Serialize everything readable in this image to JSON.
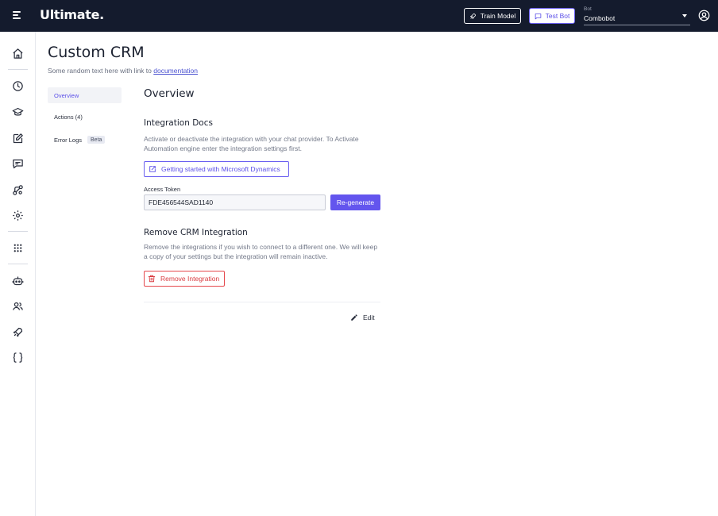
{
  "topbar": {
    "logo": "Ultimate.",
    "train_model_label": "Train Model",
    "test_bot_label": "Test Bot",
    "bot_select": {
      "label": "Bot",
      "value": "Combobot"
    }
  },
  "page": {
    "title": "Custom CRM",
    "subtitle_text": "Some random text here with link to",
    "subtitle_link": "documentation"
  },
  "subnav": {
    "items": [
      {
        "label": "Overview",
        "active": true
      },
      {
        "label": "Actions (4)",
        "active": false
      },
      {
        "label": "Error Logs",
        "badge": "Beta",
        "active": false
      }
    ]
  },
  "main": {
    "heading": "Overview",
    "integration_docs": {
      "heading": "Integration Docs",
      "description": "Activate or deactivate the integration with your chat provider. To Activate Automation engine enter the integration settings first.",
      "doc_button_label": "Getting started with Microsoft Dynamics"
    },
    "access_token": {
      "label": "Access Token",
      "value": "FDE456544SAD1140",
      "regenerate_label": "Re-generate"
    },
    "remove_section": {
      "heading": "Remove CRM Integration",
      "description": "Remove the integrations if you wish to connect to a different one. We will keep a copy of your settings but the integration will remain inactive.",
      "remove_button_label": "Remove Integration"
    },
    "edit_label": "Edit"
  },
  "rail_icons": [
    "home-icon",
    "history-icon",
    "training-icon",
    "edit-icon",
    "conversations-icon",
    "flows-icon",
    "settings-icon",
    "apps-grid-icon",
    "bot-icon",
    "users-icon",
    "rocket-icon",
    "code-braces-icon"
  ],
  "colors": {
    "topbar": "#141b2d",
    "accent": "#6355ee",
    "danger": "#e5484d"
  }
}
